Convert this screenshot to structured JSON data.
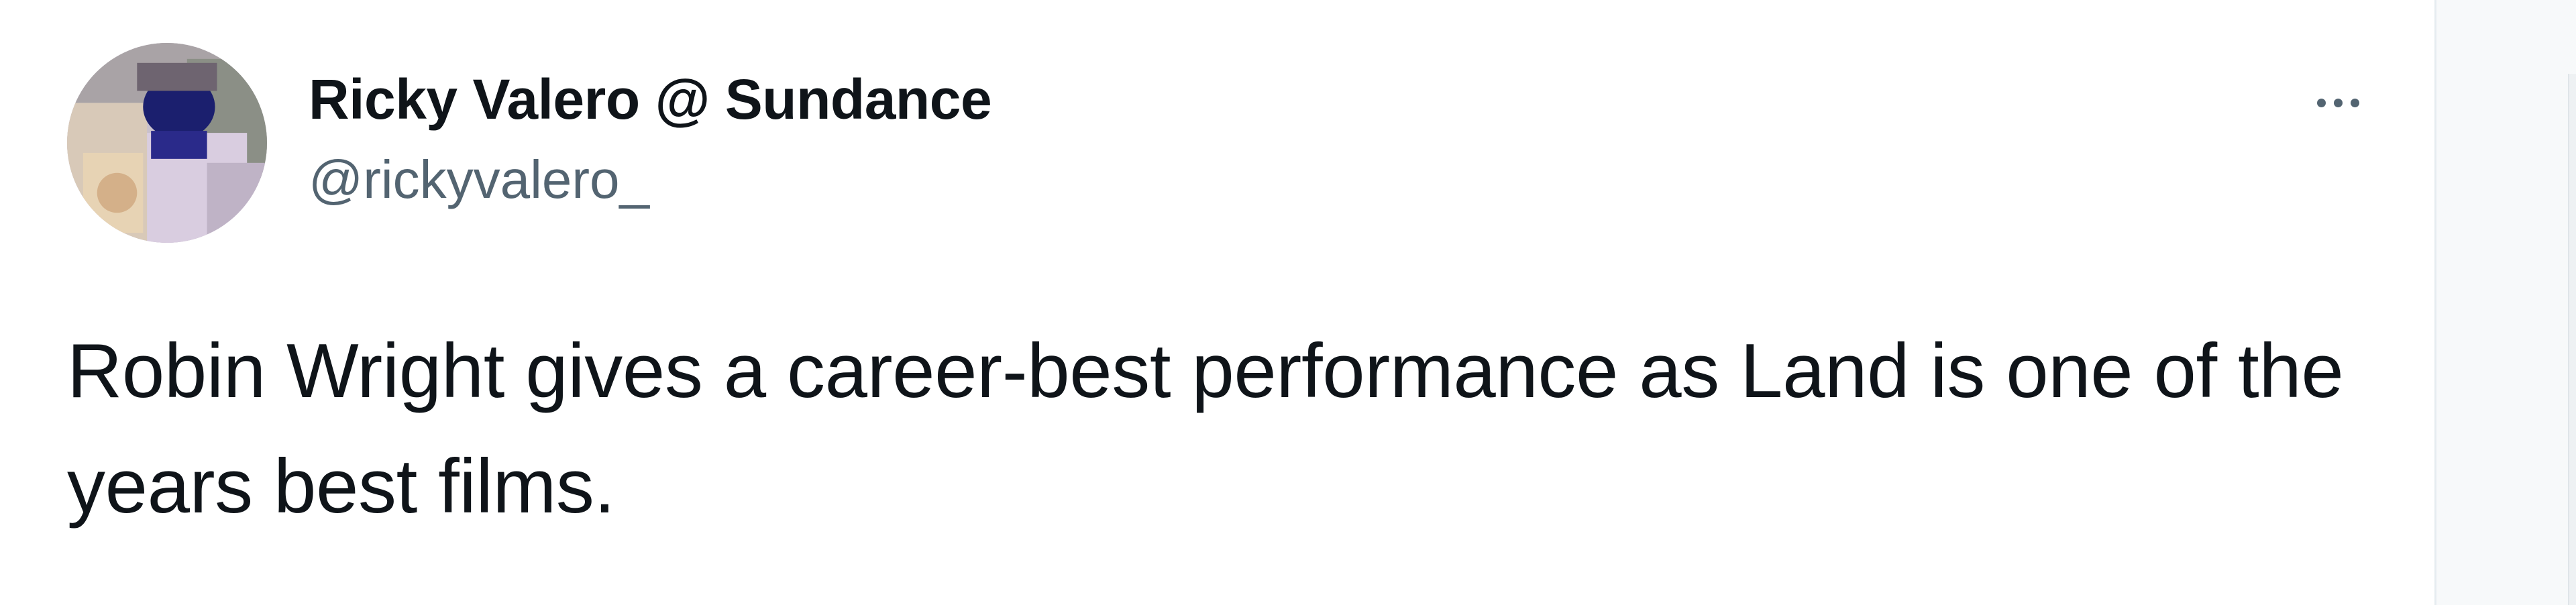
{
  "tweet": {
    "author": {
      "display_name": "Ricky Valero @ Sundance",
      "handle": "@rickyvalero_",
      "avatar_icon": "profile-photo-icon"
    },
    "more_icon": "more-horizontal-icon",
    "text": "Robin Wright gives a career-best performance as Land is one of the years best films."
  },
  "colors": {
    "text_primary": "#0f1419",
    "text_secondary": "#536471",
    "card_background": "#ffffff"
  }
}
